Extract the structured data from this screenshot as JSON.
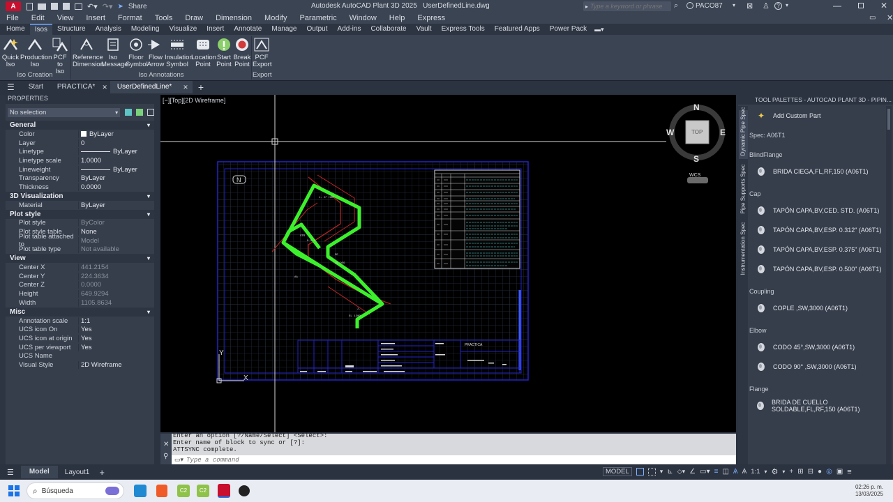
{
  "app": {
    "title": "Autodesk AutoCAD Plant 3D 2025   UserDefinedLine.dwg",
    "logo_label": "A",
    "logo_sub": "P3D",
    "share_label": "Share",
    "search_placeholder": "Type a keyword or phrase",
    "user": "PACO87"
  },
  "menu": [
    "File",
    "Edit",
    "View",
    "Insert",
    "Format",
    "Tools",
    "Draw",
    "Dimension",
    "Modify",
    "Parametric",
    "Window",
    "Help",
    "Express"
  ],
  "ribbon_tabs": [
    "Home",
    "Isos",
    "Structure",
    "Analysis",
    "Modeling",
    "Visualize",
    "Insert",
    "Annotate",
    "Manage",
    "Output",
    "Add-ins",
    "Collaborate",
    "Vault",
    "Express Tools",
    "Featured Apps",
    "Power Pack"
  ],
  "ribbon": {
    "iso_creation": {
      "label": "Iso Creation",
      "buttons": [
        {
          "line1": "Quick",
          "line2": "Iso",
          "icon": "quick-iso-icon"
        },
        {
          "line1": "Production",
          "line2": "Iso",
          "icon": "production-iso-icon"
        },
        {
          "line1": "PCF to",
          "line2": "Iso",
          "icon": "pcf-to-iso-icon"
        }
      ]
    },
    "iso_annotations": {
      "label": "Iso Annotations",
      "buttons": [
        {
          "line1": "Reference",
          "line2": "Dimension",
          "icon": "reference-dimension-icon"
        },
        {
          "line1": "Iso",
          "line2": "Message",
          "icon": "iso-message-icon"
        },
        {
          "line1": "Floor",
          "line2": "Symbol",
          "icon": "floor-symbol-icon"
        },
        {
          "line1": "Flow",
          "line2": "Arrow",
          "icon": "flow-arrow-icon"
        },
        {
          "line1": "Insulation",
          "line2": "Symbol",
          "icon": "insulation-symbol-icon"
        },
        {
          "line1": "Location",
          "line2": "Point",
          "icon": "location-point-icon"
        },
        {
          "line1": "Start",
          "line2": "Point",
          "icon": "start-point-icon"
        },
        {
          "line1": "Break",
          "line2": "Point",
          "icon": "break-point-icon"
        }
      ]
    },
    "export": {
      "label": "Export",
      "buttons": [
        {
          "line1": "PCF",
          "line2": "Export",
          "icon": "pcf-export-icon"
        }
      ]
    }
  },
  "file_tabs": [
    "Start",
    "PRACTICA*",
    "UserDefinedLine*"
  ],
  "properties": {
    "title": "PROPERTIES",
    "selection": "No selection",
    "sections": [
      {
        "name": "General",
        "rows": [
          [
            "Color",
            "ByLayer"
          ],
          [
            "Layer",
            "0"
          ],
          [
            "Linetype",
            "ByLayer"
          ],
          [
            "Linetype scale",
            "1.0000"
          ],
          [
            "Lineweight",
            "ByLayer"
          ],
          [
            "Transparency",
            "ByLayer"
          ],
          [
            "Thickness",
            "0.0000"
          ]
        ]
      },
      {
        "name": "3D Visualization",
        "rows": [
          [
            "Material",
            "ByLayer"
          ]
        ]
      },
      {
        "name": "Plot style",
        "rows": [
          [
            "Plot style",
            "ByColor"
          ],
          [
            "Plot style table",
            "None"
          ],
          [
            "Plot table attached to",
            "Model"
          ],
          [
            "Plot table type",
            "Not available"
          ]
        ]
      },
      {
        "name": "View",
        "rows": [
          [
            "Center X",
            "441.2154"
          ],
          [
            "Center Y",
            "224.3634"
          ],
          [
            "Center Z",
            "0.0000"
          ],
          [
            "Height",
            "649.9294"
          ],
          [
            "Width",
            "1105.8634"
          ]
        ]
      },
      {
        "name": "Misc",
        "rows": [
          [
            "Annotation scale",
            "1:1"
          ],
          [
            "UCS icon On",
            "Yes"
          ],
          [
            "UCS icon at origin",
            "Yes"
          ],
          [
            "UCS per viewport",
            "Yes"
          ],
          [
            "UCS Name",
            ""
          ],
          [
            "Visual Style",
            "2D Wireframe"
          ]
        ]
      }
    ]
  },
  "viewport": {
    "label": "[−][Top][2D Wireframe]",
    "viewcube": {
      "n": "N",
      "s": "S",
      "e": "E",
      "w": "W",
      "top": "TOP",
      "wcs": "WCS"
    },
    "drawing": {
      "project": "PRACTICA",
      "north": "N"
    }
  },
  "command": {
    "lines": [
      "Enter an option [?/Name/Select] <Select>:",
      "Enter name of block to sync or [?]:",
      "ATTSYNC complete."
    ],
    "placeholder": "Type a command"
  },
  "tool_palette": {
    "title": "TOOL PALETTES - AUTOCAD PLANT 3D - PIPIN...",
    "side_tabs": [
      "Dynamic Pipe Spec",
      "Pipe Supports Spec",
      "Instrumentation Spec"
    ],
    "add_custom": "Add Custom Part",
    "spec": "Spec: A06T1",
    "categories": [
      {
        "name": "BlindFlange",
        "items": [
          "BRIDA CIEGA,FL,RF,150 (A06T1)"
        ]
      },
      {
        "name": "Cap",
        "items": [
          "TAPÓN CAPA,BV,CED. STD. (A06T1)",
          "TAPÓN CAPA,BV,ESP. 0.312\" (A06T1)",
          "TAPÓN CAPA,BV,ESP. 0.375\" (A06T1)",
          "TAPÓN CAPA,BV,ESP. 0.500\" (A06T1)"
        ]
      },
      {
        "name": "Coupling",
        "items": [
          "COPLE ,SW,3000 (A06T1)"
        ]
      },
      {
        "name": "Elbow",
        "items": [
          "CODO 45°,SW,3000 (A06T1)",
          "CODO 90° ,SW,3000 (A06T1)"
        ]
      },
      {
        "name": "Flange",
        "items": [
          "BRIDA DE CUELLO SOLDABLE,FL,RF,150 (A06T1)"
        ]
      }
    ]
  },
  "status": {
    "model_tab": "Model",
    "layout_tab": "Layout1",
    "model_btn": "MODEL",
    "scale": "1:1"
  },
  "taskbar": {
    "search": "Búsqueda",
    "time": "02:26 p. m.",
    "date": "13/03/2025"
  }
}
